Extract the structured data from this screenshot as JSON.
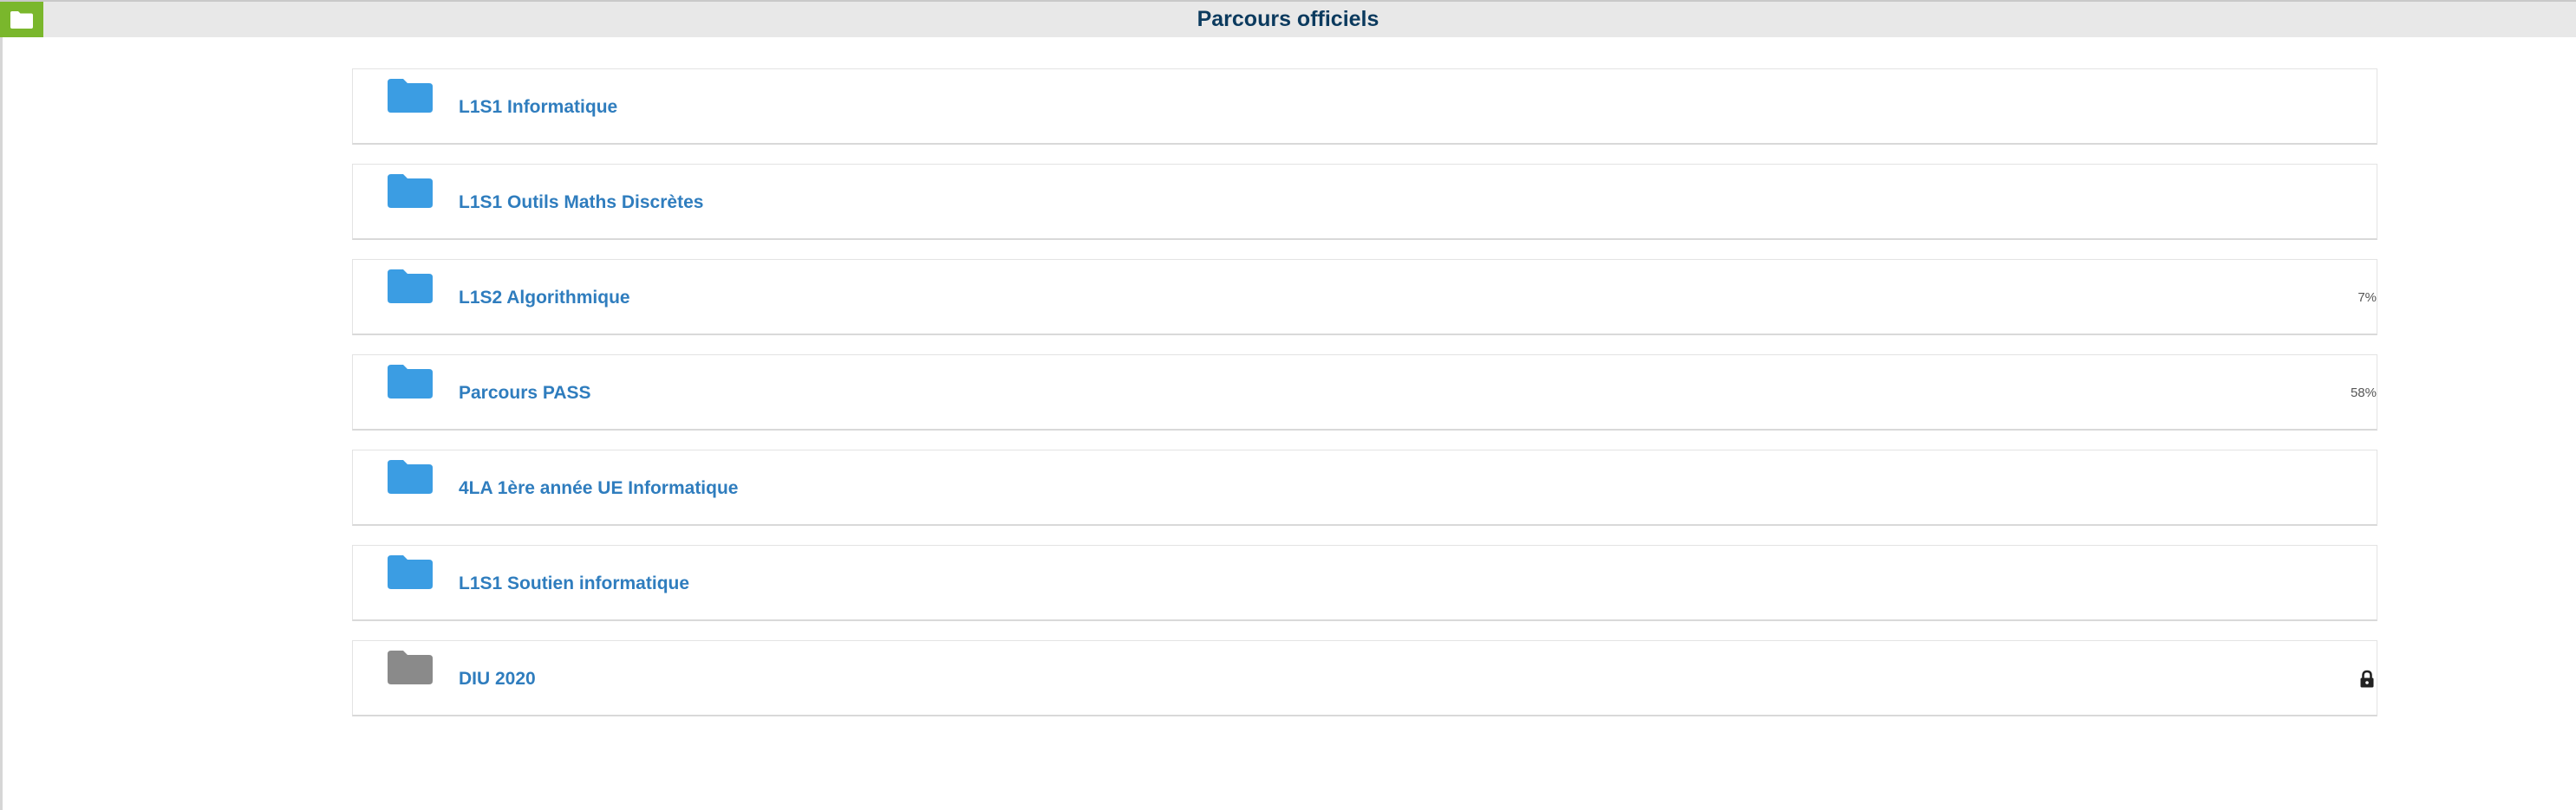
{
  "header": {
    "title": "Parcours officiels",
    "home_icon": "folder-icon"
  },
  "courses": [
    {
      "label": "L1S1 Informatique",
      "progress": "",
      "locked": false,
      "folder_color": "#3b9de3"
    },
    {
      "label": "L1S1 Outils Maths Discrètes",
      "progress": "",
      "locked": false,
      "folder_color": "#3b9de3"
    },
    {
      "label": "L1S2 Algorithmique",
      "progress": "7%",
      "locked": false,
      "folder_color": "#3b9de3"
    },
    {
      "label": "Parcours PASS",
      "progress": "58%",
      "locked": false,
      "folder_color": "#3b9de3"
    },
    {
      "label": "4LA 1ère année UE Informatique",
      "progress": "",
      "locked": false,
      "folder_color": "#3b9de3"
    },
    {
      "label": "L1S1 Soutien informatique",
      "progress": "",
      "locked": false,
      "folder_color": "#3b9de3"
    },
    {
      "label": "DIU 2020",
      "progress": "",
      "locked": true,
      "folder_color": "#8a8a8a"
    }
  ],
  "colors": {
    "accent": "#7ab72c",
    "title": "#0b3a5e",
    "link": "#2f7dbe"
  }
}
